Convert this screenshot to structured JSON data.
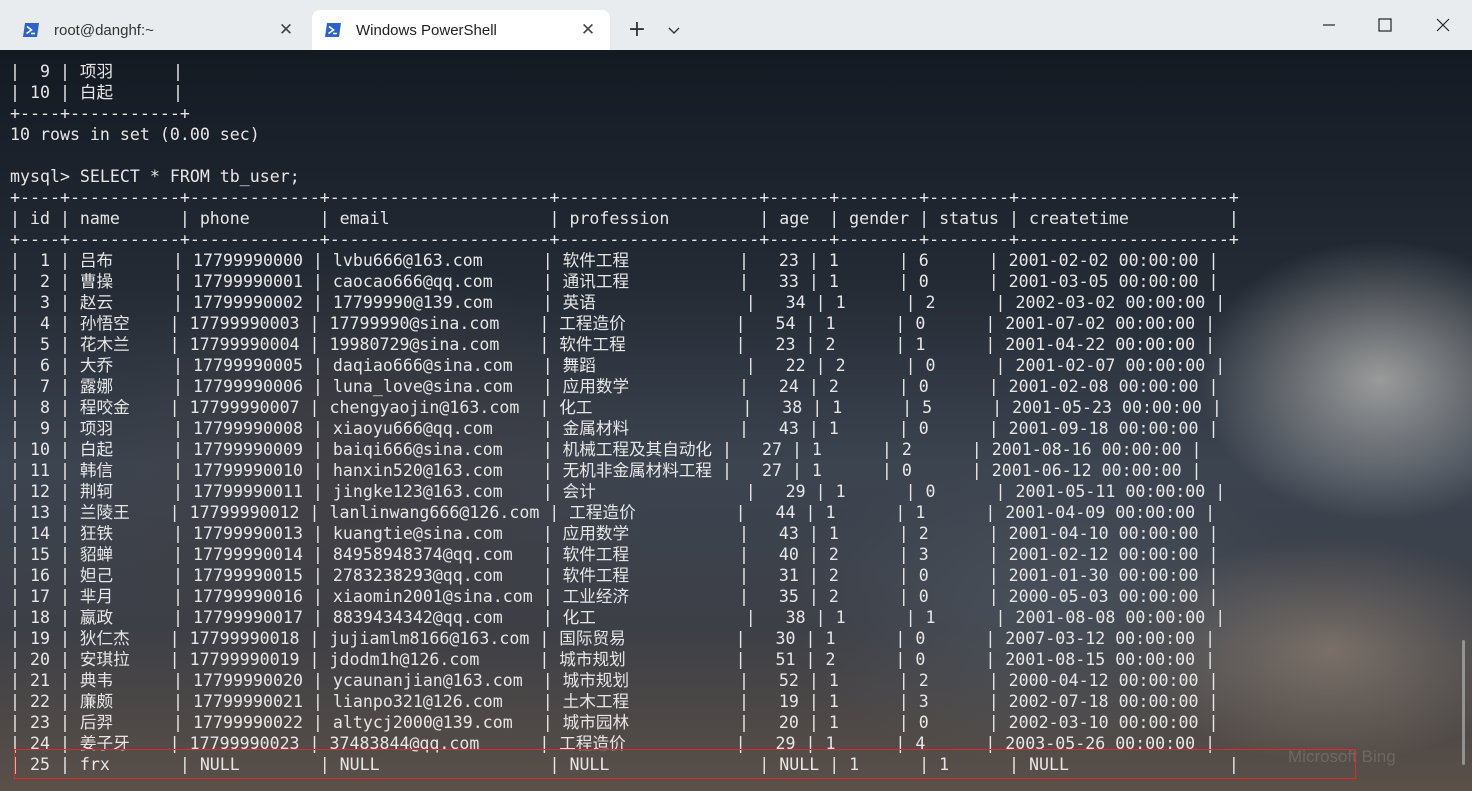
{
  "tabs": [
    {
      "label": "root@danghf:~",
      "active": false
    },
    {
      "label": "Windows PowerShell",
      "active": true
    }
  ],
  "new_tab_label": "+",
  "terminal": {
    "lines": [
      "|  9 | 项羽      |",
      "| 10 | 白起      |",
      "+----+-----------+",
      "10 rows in set (0.00 sec)",
      "",
      "mysql> SELECT * FROM tb_user;",
      "+----+-----------+-------------+----------------------+--------------------+------+--------+--------+---------------------+",
      "| id | name      | phone       | email                | profession         | age  | gender | status | createtime          |",
      "+----+-----------+-------------+----------------------+--------------------+------+--------+--------+---------------------+",
      "|  1 | 吕布      | 17799990000 | lvbu666@163.com      | 软件工程           |   23 | 1      | 6      | 2001-02-02 00:00:00 |",
      "|  2 | 曹操      | 17799990001 | caocao666@qq.com     | 通讯工程           |   33 | 1      | 0      | 2001-03-05 00:00:00 |",
      "|  3 | 赵云      | 17799990002 | 17799990@139.com     | 英语               |   34 | 1      | 2      | 2002-03-02 00:00:00 |",
      "|  4 | 孙悟空    | 17799990003 | 17799990@sina.com    | 工程造价           |   54 | 1      | 0      | 2001-07-02 00:00:00 |",
      "|  5 | 花木兰    | 17799990004 | 19980729@sina.com    | 软件工程           |   23 | 2      | 1      | 2001-04-22 00:00:00 |",
      "|  6 | 大乔      | 17799990005 | daqiao666@sina.com   | 舞蹈               |   22 | 2      | 0      | 2001-02-07 00:00:00 |",
      "|  7 | 露娜      | 17799990006 | luna_love@sina.com   | 应用数学           |   24 | 2      | 0      | 2001-02-08 00:00:00 |",
      "|  8 | 程咬金    | 17799990007 | chengyaojin@163.com  | 化工               |   38 | 1      | 5      | 2001-05-23 00:00:00 |",
      "|  9 | 项羽      | 17799990008 | xiaoyu666@qq.com     | 金属材料           |   43 | 1      | 0      | 2001-09-18 00:00:00 |",
      "| 10 | 白起      | 17799990009 | baiqi666@sina.com    | 机械工程及其自动化 |   27 | 1      | 2      | 2001-08-16 00:00:00 |",
      "| 11 | 韩信      | 17799990010 | hanxin520@163.com    | 无机非金属材料工程 |   27 | 1      | 0      | 2001-06-12 00:00:00 |",
      "| 12 | 荆轲      | 17799990011 | jingke123@163.com    | 会计               |   29 | 1      | 0      | 2001-05-11 00:00:00 |",
      "| 13 | 兰陵王    | 17799990012 | lanlinwang666@126.com | 工程造价          |   44 | 1      | 1      | 2001-04-09 00:00:00 |",
      "| 14 | 狂铁      | 17799990013 | kuangtie@sina.com    | 应用数学           |   43 | 1      | 2      | 2001-04-10 00:00:00 |",
      "| 15 | 貂蝉      | 17799990014 | 84958948374@qq.com   | 软件工程           |   40 | 2      | 3      | 2001-02-12 00:00:00 |",
      "| 16 | 妲己      | 17799990015 | 2783238293@qq.com    | 软件工程           |   31 | 2      | 0      | 2001-01-30 00:00:00 |",
      "| 17 | 芈月      | 17799990016 | xiaomin2001@sina.com | 工业经济           |   35 | 2      | 0      | 2000-05-03 00:00:00 |",
      "| 18 | 嬴政      | 17799990017 | 8839434342@qq.com    | 化工               |   38 | 1      | 1      | 2001-08-08 00:00:00 |",
      "| 19 | 狄仁杰    | 17799990018 | jujiamlm8166@163.com | 国际贸易           |   30 | 1      | 0      | 2007-03-12 00:00:00 |",
      "| 20 | 安琪拉    | 17799990019 | jdodm1h@126.com      | 城市规划           |   51 | 2      | 0      | 2001-08-15 00:00:00 |",
      "| 21 | 典韦      | 17799990020 | ycaunanjian@163.com  | 城市规划           |   52 | 1      | 2      | 2000-04-12 00:00:00 |",
      "| 22 | 廉颇      | 17799990021 | lianpo321@126.com    | 土木工程           |   19 | 1      | 3      | 2002-07-18 00:00:00 |",
      "| 23 | 后羿      | 17799990022 | altycj2000@139.com   | 城市园林           |   20 | 1      | 0      | 2002-03-10 00:00:00 |",
      "| 24 | 姜子牙    | 17799990023 | 37483844@qq.com      | 工程造价           |   29 | 1      | 4      | 2003-05-26 00:00:00 |",
      "| 25 | frx       | NULL        | NULL                 | NULL               | NULL | 1      | 1      | NULL                |"
    ]
  },
  "background_watermark": "Microsoft Bing",
  "colors": {
    "titlebar": "#e9ecef",
    "active_tab": "#ffffff",
    "terminal_text": "#e6e6e6",
    "highlight_border": "#e02828",
    "powershell_icon": "#2b63c7"
  }
}
